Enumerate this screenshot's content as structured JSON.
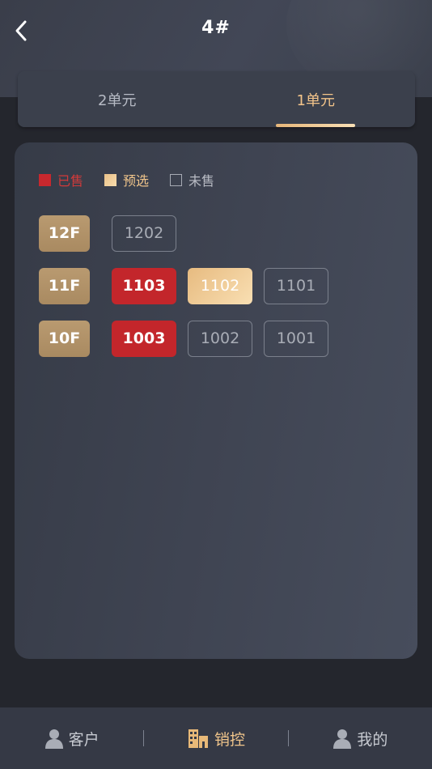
{
  "header": {
    "title": "4#"
  },
  "tabs": [
    {
      "label": "2单元",
      "active": false
    },
    {
      "label": "1单元",
      "active": true
    }
  ],
  "legend": {
    "sold": "已售",
    "preselected": "预选",
    "unsold": "未售"
  },
  "floors": [
    {
      "label": "12F",
      "units": [
        {
          "number": "1202",
          "status": "unsold"
        }
      ]
    },
    {
      "label": "11F",
      "units": [
        {
          "number": "1103",
          "status": "sold"
        },
        {
          "number": "1102",
          "status": "preselected"
        },
        {
          "number": "1101",
          "status": "unsold"
        }
      ]
    },
    {
      "label": "10F",
      "units": [
        {
          "number": "1003",
          "status": "sold"
        },
        {
          "number": "1002",
          "status": "unsold"
        },
        {
          "number": "1001",
          "status": "unsold"
        }
      ]
    }
  ],
  "nav": {
    "customers": "客户",
    "sales_control": "销控",
    "mine": "我的"
  },
  "colors": {
    "sold": "#c3262b",
    "preselected": "#f0c58b",
    "floor_badge": "#b0916a",
    "accent": "#f3c48a"
  }
}
